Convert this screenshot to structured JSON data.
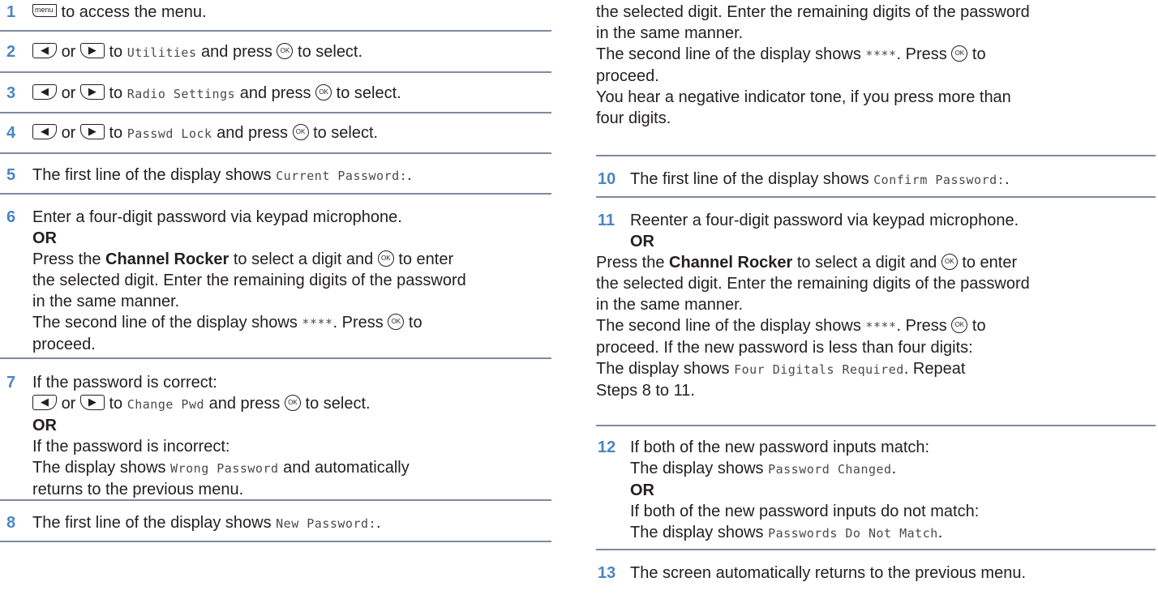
{
  "icons": {
    "menu_key": "menu",
    "left": "◀",
    "right": "▶",
    "ok": "OK"
  },
  "left": {
    "s1": {
      "num": "1",
      "t1": " to access the menu."
    },
    "s2": {
      "num": "2",
      "or": "or",
      "t1": " to ",
      "mono": "Utilities",
      "t2": " and press ",
      "t3": " to select."
    },
    "s3": {
      "num": "3",
      "or": "or",
      "t1": " to ",
      "mono": "Radio Settings",
      "t2": " and press ",
      "t3": " to select."
    },
    "s4": {
      "num": "4",
      "or": "or",
      "t1": " to ",
      "mono": "Passwd Lock",
      "t2": " and press ",
      "t3": " to select."
    },
    "s5": {
      "num": "5",
      "t1": "The first line of the display shows ",
      "mono": "Current Password:",
      "t2": "."
    },
    "s6": {
      "num": "6",
      "l1": "Enter a four-digit password via keypad microphone.",
      "or": "OR",
      "l3a": "Press the ",
      "l3b": "Channel Rocker",
      "l3c": " to select a digit and ",
      "l3d": " to enter",
      "l4": "the selected digit. Enter the remaining digits of the password",
      "l5": "in the same manner.",
      "l6a": "The second line of the display shows ",
      "l6m": "****",
      "l6b": ". Press ",
      "l6c": " to",
      "l7": "proceed."
    },
    "s7": {
      "num": "7",
      "l1": "If the password is correct:",
      "l2or": "or",
      "l2a": " to ",
      "l2m": "Change Pwd",
      "l2b": " and press ",
      "l2c": " to select.",
      "or": "OR",
      "l4": "If the password is incorrect:",
      "l5a": "The display shows ",
      "l5m": "Wrong Password",
      "l5b": " and automatically",
      "l6": "returns to the previous menu."
    },
    "s8": {
      "num": "8",
      "t1": "The first line of the display shows ",
      "mono": "New Password:",
      "t2": "."
    }
  },
  "right": {
    "s9": {
      "l1a": "the selected digit. Enter the remaining digits of the password",
      "l2": "in the same manner.",
      "l3a": "The second line of the display shows ",
      "l3m": "****",
      "l3b": ". Press ",
      "l3c": " to",
      "l4": "proceed.",
      "l5": "You hear a negative indicator tone, if you press more than",
      "l6": "four digits."
    },
    "s10": {
      "num": "10",
      "t1": "The first line of the display shows ",
      "mono": "Confirm Password:",
      "t2": "."
    },
    "s11": {
      "num": "11",
      "l1": "Reenter a four-digit password via keypad microphone.",
      "or": "OR",
      "l3a": "Press the ",
      "l3b": "Channel Rocker",
      "l3c": " to select a digit and ",
      "l3d": " to enter",
      "l4": "the selected digit. Enter the remaining digits of the password",
      "l5": "in the same manner.",
      "l6a": "The second line of the display shows ",
      "l6m": "****",
      "l6b": ". Press ",
      "l6c": " to",
      "l7": "proceed. If the new password is less than four digits:",
      "l8a": "The display shows ",
      "l8m": "Four Digitals Required",
      "l8b": ". Repeat",
      "l9": "Steps 8 to 11."
    },
    "s12": {
      "num": "12",
      "l1": "If both of the new password inputs match:",
      "l2a": "The display shows ",
      "l2m": "Password Changed",
      "l2b": ".",
      "or": "OR",
      "l4": "If both of the new password inputs do not match:",
      "l5a": "The display shows ",
      "l5m": "Passwords Do Not Match",
      "l5b": "."
    },
    "s13": {
      "num": "13",
      "t1": "The screen automatically returns to the previous menu."
    }
  }
}
